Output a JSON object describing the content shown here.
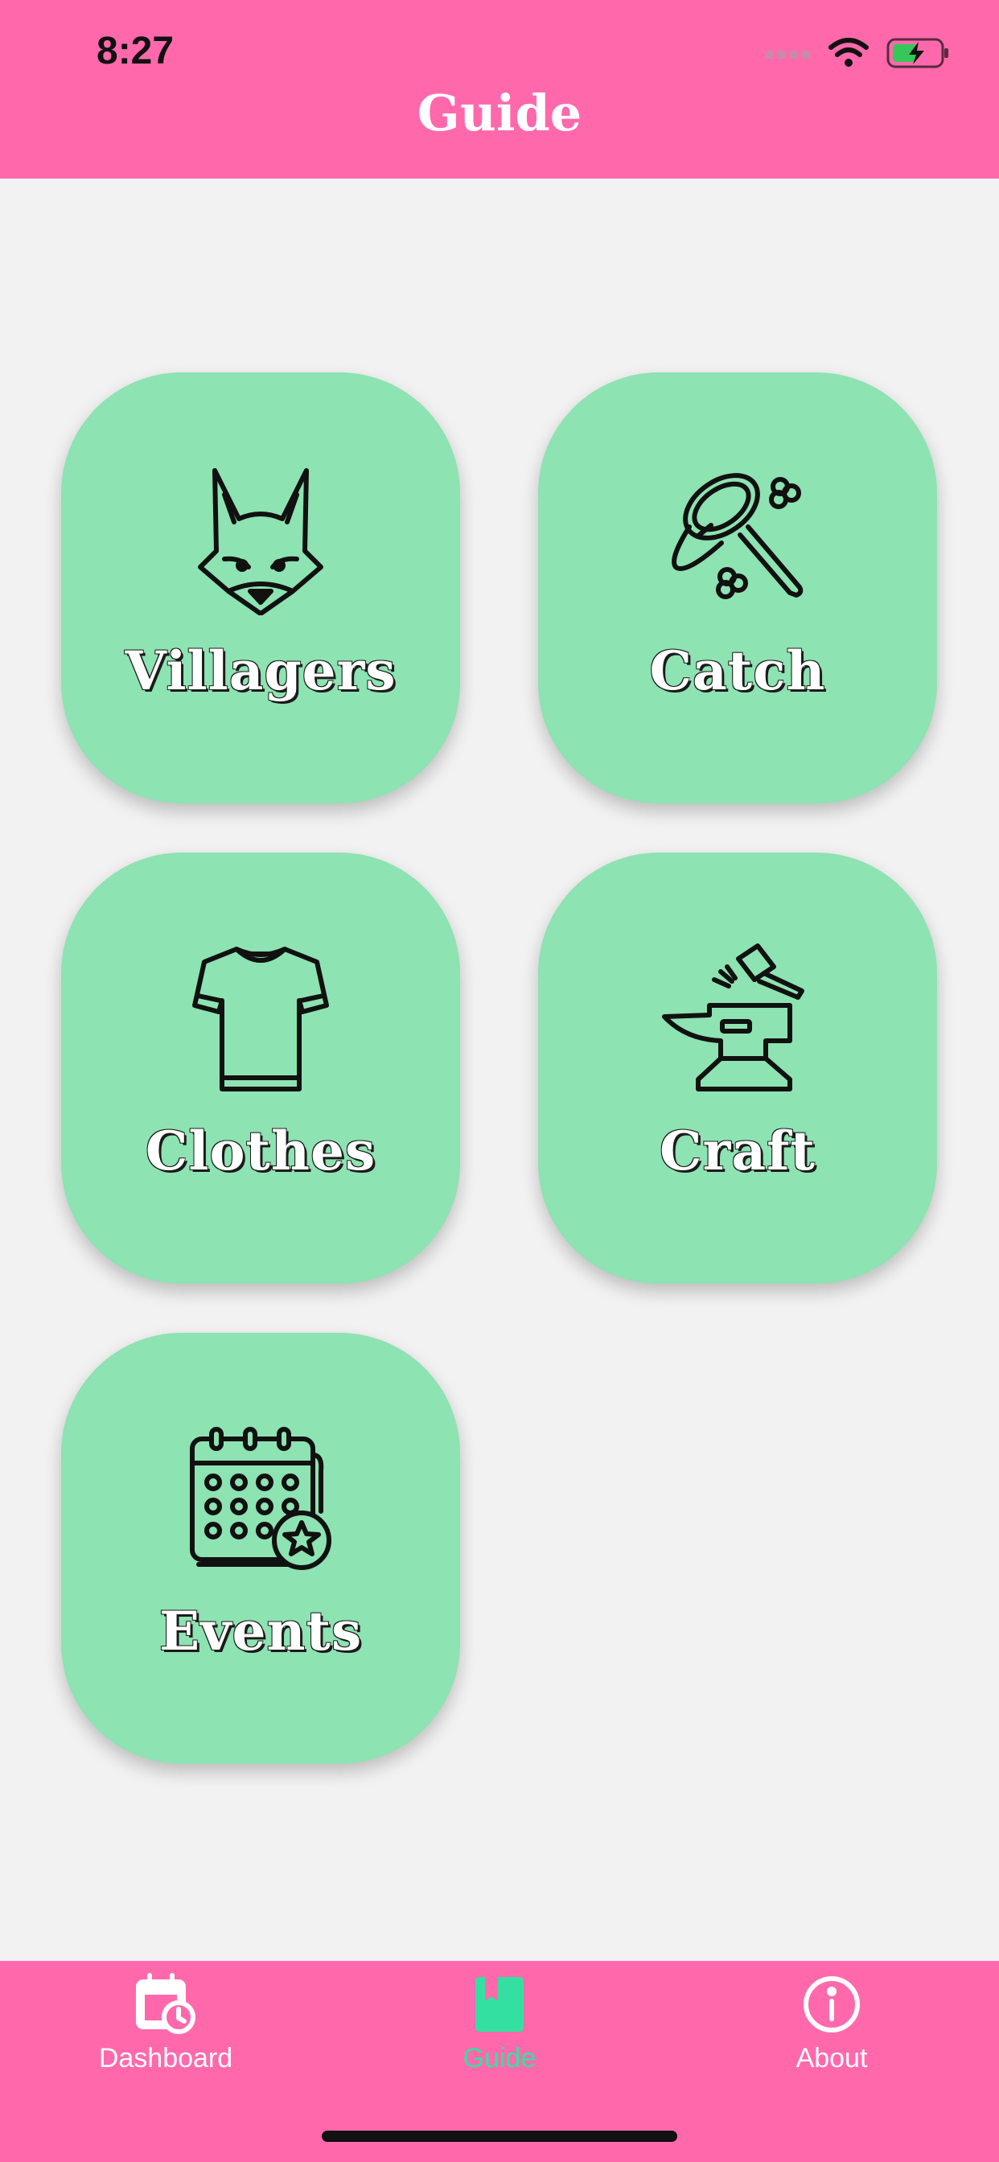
{
  "status_bar": {
    "time": "8:27"
  },
  "header": {
    "title": "Guide"
  },
  "tiles": [
    {
      "label": "Villagers",
      "icon": "fox-icon"
    },
    {
      "label": "Catch",
      "icon": "bug-net-icon"
    },
    {
      "label": "Clothes",
      "icon": "tshirt-icon"
    },
    {
      "label": "Craft",
      "icon": "anvil-hammer-icon"
    },
    {
      "label": "Events",
      "icon": "calendar-star-icon"
    }
  ],
  "tabbar": {
    "items": [
      {
        "label": "Dashboard",
        "icon": "calendar-clock-icon",
        "active": false
      },
      {
        "label": "Guide",
        "icon": "book-bookmark-icon",
        "active": true
      },
      {
        "label": "About",
        "icon": "info-icon",
        "active": false
      }
    ]
  },
  "colors": {
    "header": "#ff69ac",
    "tile": "#8de3b1",
    "background": "#f2f2f2",
    "active_tab": "#34e0a1"
  }
}
